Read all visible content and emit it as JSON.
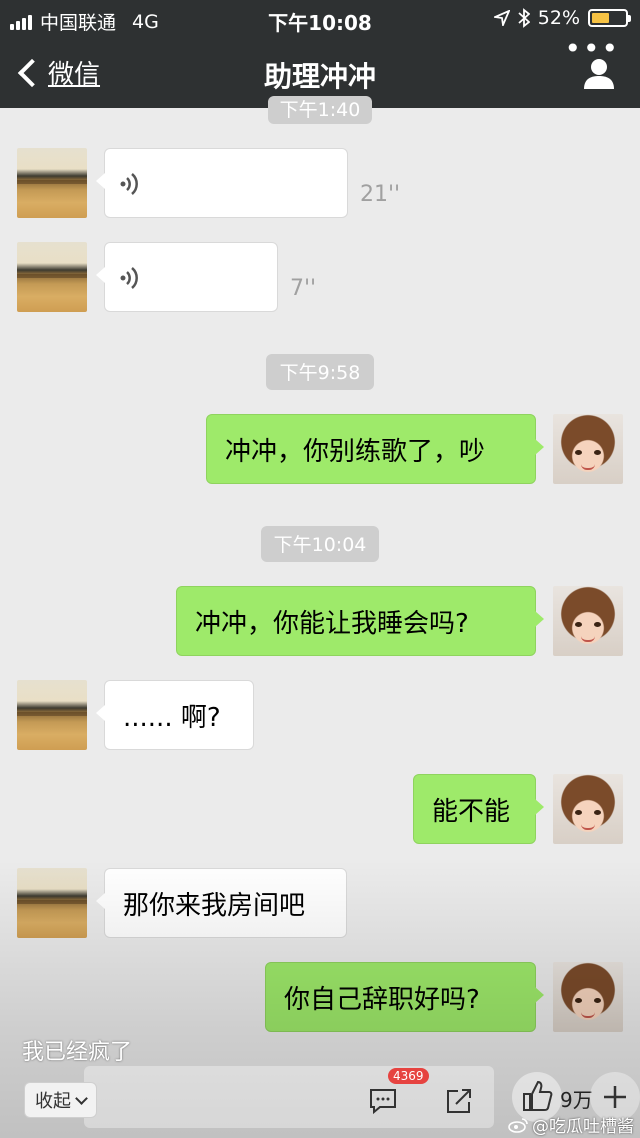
{
  "status_bar": {
    "carrier": "中国联通",
    "network": "4G",
    "time": "下午10:08",
    "battery": "52%",
    "battery_level": 0.52
  },
  "nav": {
    "back_label": "微信",
    "title": "助理冲冲",
    "more": "•••"
  },
  "messages": [
    {
      "type": "timestamp",
      "text": "下午1:40"
    },
    {
      "type": "voice",
      "from": "other",
      "duration": "21''"
    },
    {
      "type": "voice",
      "from": "other",
      "duration": "7''"
    },
    {
      "type": "timestamp",
      "text": "下午9:58"
    },
    {
      "type": "text",
      "from": "me",
      "text": "冲冲，你别练歌了，吵"
    },
    {
      "type": "timestamp",
      "text": "下午10:04"
    },
    {
      "type": "text",
      "from": "me",
      "text": "冲冲，你能让我睡会吗?"
    },
    {
      "type": "text",
      "from": "other",
      "text": "...... 啊?"
    },
    {
      "type": "text",
      "from": "me",
      "text": "能不能"
    },
    {
      "type": "text",
      "from": "other",
      "text": "那你来我房间吧"
    },
    {
      "type": "text",
      "from": "me",
      "text": "你自己辞职好吗?"
    }
  ],
  "caption": "我已经疯了",
  "bottom": {
    "collapse_label": "收起",
    "comment_count": "4369",
    "like_count": "9万"
  },
  "watermark": "@吃瓜吐槽酱",
  "colors": {
    "bar_bg": "#2e3132",
    "chat_bg": "#ebebeb",
    "outgoing_bubble": "#9eea6a",
    "incoming_bubble": "#ffffff",
    "timestamp_bg": "#cecece",
    "badge": "#e64340"
  }
}
